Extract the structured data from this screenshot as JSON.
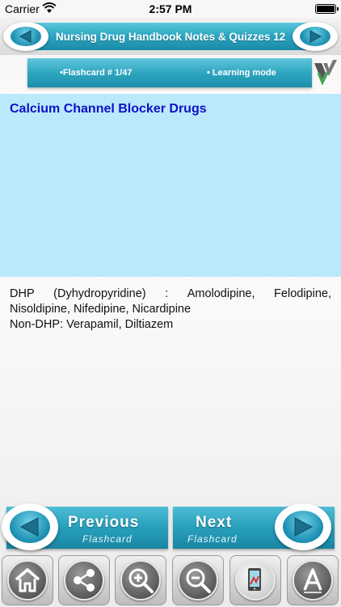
{
  "status_bar": {
    "carrier": "Carrier",
    "time": "2:57 PM"
  },
  "header": {
    "title": "Nursing Drug Handbook Notes & Quizzes 12"
  },
  "info_bar": {
    "flashcard_count": "•Flashcard #  1/47",
    "mode": "• Learning mode"
  },
  "card": {
    "question": "Calcium Channel Blocker Drugs",
    "answer": {
      "line1_parts": [
        "DHP",
        "(Dyhydropyridine)",
        ":",
        "Amolodipine,",
        "Felodipine,"
      ],
      "line2": "Nisoldipine, Nifedipine, Nicardipine",
      "line3": "Non-DHP: Verapamil, Diltiazem"
    }
  },
  "navigation": {
    "previous": {
      "label": "Previous",
      "sub": "Flashcard"
    },
    "next": {
      "label": "Next",
      "sub": "Flashcard"
    }
  },
  "toolbar": {
    "icons": [
      "home-icon",
      "share-icon",
      "zoom-in-icon",
      "zoom-out-icon",
      "phone-settings-icon",
      "font-size-icon"
    ]
  },
  "colors": {
    "accent": "#2aa4c0",
    "question_bg": "#b9e9fb",
    "question_text": "#1010c8"
  }
}
